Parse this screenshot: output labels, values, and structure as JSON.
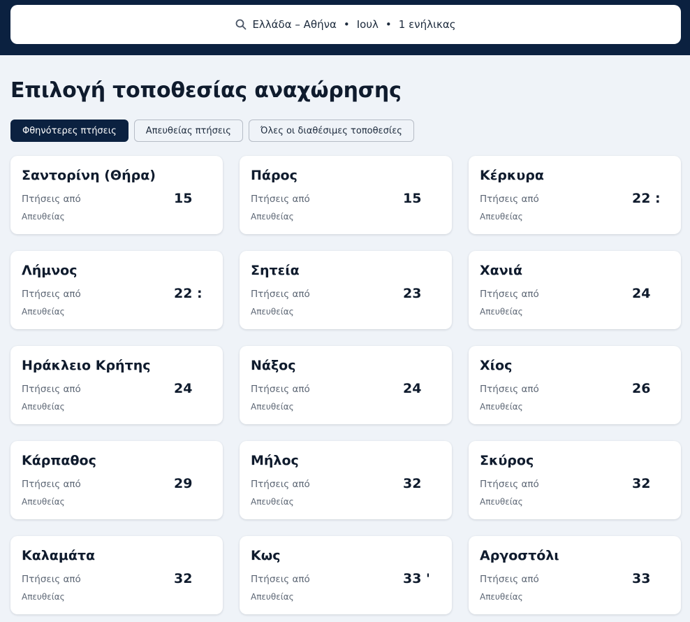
{
  "search": {
    "destination": "Ελλάδα – Αθήνα",
    "month": "Ιουλ",
    "travellers": "1 ενήλικας",
    "separator": "•",
    "icon": "search-icon"
  },
  "page_title": "Επιλογή τοποθεσίας αναχώρησης",
  "tabs": [
    {
      "label": "Φθηνότερες πτήσεις",
      "active": true
    },
    {
      "label": "Απευθείας πτήσεις",
      "active": false
    },
    {
      "label": "Όλες οι διαθέσιμες τοποθεσίες",
      "active": false
    }
  ],
  "cards": [
    {
      "name": "Σαντορίνη (Θήρα)",
      "from_label": "Πτήσεις από",
      "price": "15",
      "direct_label": "Απευθείας"
    },
    {
      "name": "Πάρος",
      "from_label": "Πτήσεις από",
      "price": "15",
      "direct_label": "Απευθείας"
    },
    {
      "name": "Κέρκυρα",
      "from_label": "Πτήσεις από",
      "price": "22 :",
      "direct_label": "Απευθείας"
    },
    {
      "name": "Λήμνος",
      "from_label": "Πτήσεις από",
      "price": "22 :",
      "direct_label": "Απευθείας"
    },
    {
      "name": "Σητεία",
      "from_label": "Πτήσεις από",
      "price": "23",
      "direct_label": "Απευθείας"
    },
    {
      "name": "Χανιά",
      "from_label": "Πτήσεις από",
      "price": "24",
      "direct_label": "Απευθείας"
    },
    {
      "name": "Ηράκλειο Κρήτης",
      "from_label": "Πτήσεις από",
      "price": "24",
      "direct_label": "Απευθείας"
    },
    {
      "name": "Νάξος",
      "from_label": "Πτήσεις από",
      "price": "24",
      "direct_label": "Απευθείας"
    },
    {
      "name": "Χίος",
      "from_label": "Πτήσεις από",
      "price": "26",
      "direct_label": "Απευθείας"
    },
    {
      "name": "Κάρπαθος",
      "from_label": "Πτήσεις από",
      "price": "29",
      "direct_label": "Απευθείας"
    },
    {
      "name": "Μήλος",
      "from_label": "Πτήσεις από",
      "price": "32",
      "direct_label": "Απευθείας"
    },
    {
      "name": "Σκύρος",
      "from_label": "Πτήσεις από",
      "price": "32",
      "direct_label": "Απευθείας"
    },
    {
      "name": "Καλαμάτα",
      "from_label": "Πτήσεις από",
      "price": "32",
      "direct_label": "Απευθείας"
    },
    {
      "name": "Κως",
      "from_label": "Πτήσεις από",
      "price": "33 '",
      "direct_label": "Απευθείας"
    },
    {
      "name": "Αργοστόλι",
      "from_label": "Πτήσεις από",
      "price": "33",
      "direct_label": "Απευθείας"
    }
  ],
  "colors": {
    "header_bg": "#0b2140",
    "page_bg": "#eff3f8",
    "active_tab_bg": "#0b2140",
    "card_bg": "#ffffff",
    "muted_text": "#5b6573"
  }
}
